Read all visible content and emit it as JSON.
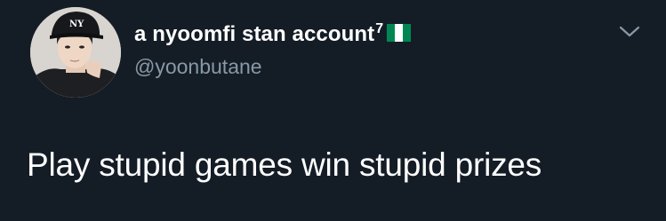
{
  "tweet": {
    "display_name": "a nyoomfi stan account",
    "name_superscript": "7",
    "flag_icon": "nigeria-flag-icon",
    "handle": "@yoonbutane",
    "text": "Play stupid games win stupid prizes",
    "menu_icon": "chevron-down-icon",
    "avatar_icon": "profile-photo"
  },
  "colors": {
    "background": "#141d26",
    "text_primary": "#ffffff",
    "text_secondary": "#8899a6",
    "flag_green": "#008751"
  }
}
